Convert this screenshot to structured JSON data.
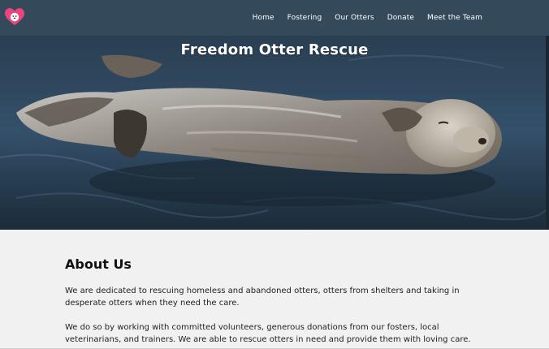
{
  "nav": {
    "logo_icon": "heart-otter-logo-icon",
    "links": [
      "Home",
      "Fostering",
      "Our Otters",
      "Donate",
      "Meet the Team"
    ]
  },
  "hero": {
    "title": "Freedom Otter Rescue",
    "image": "sea-otter-floating-photo"
  },
  "about": {
    "heading": "About Us",
    "paragraphs": [
      "We are dedicated to rescuing homeless and abandoned otters, otters from shelters and taking in desperate otters when they need the care.",
      "We do so by working with committed volunteers, generous donations from our fosters, local veterinarians, and trainers. We are able to rescue otters in need and provide them with loving care."
    ]
  },
  "colors": {
    "navbar": "#34495a",
    "logo_heart": "#e8467c",
    "background": "#f1f1f1"
  }
}
